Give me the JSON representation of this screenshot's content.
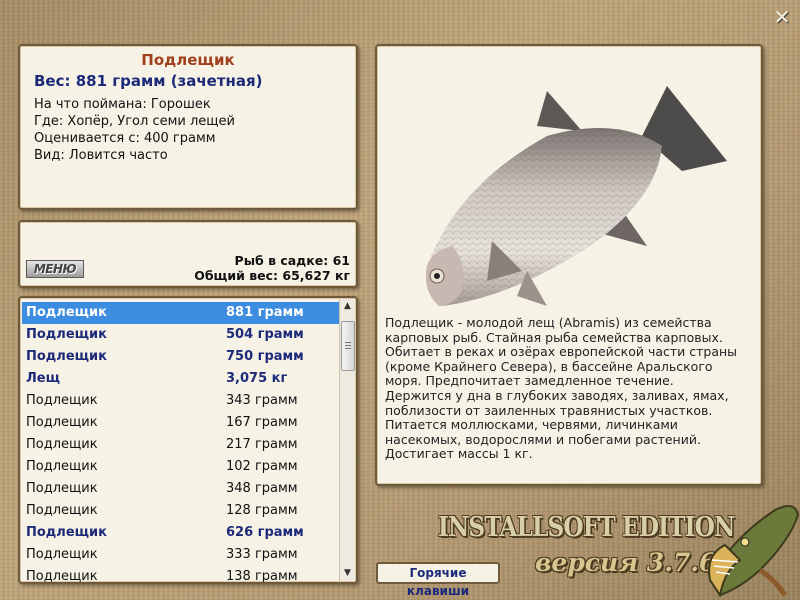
{
  "info": {
    "title": "Подлещик",
    "weight": "Вес: 881 грамм (зачетная)",
    "bait": "На что поймана: Горошек",
    "place": "Где: Хопёр, Угол семи лещей",
    "rated_from": "Оценивается с: 400 грамм",
    "kind": "Вид: Ловится часто"
  },
  "counts": {
    "menu_label": "МЕНЮ",
    "fish_in_keepnet": "Рыб в садке: 61",
    "total_weight": "Общий вес: 65,627 кг"
  },
  "catch_list": [
    {
      "name": "Подлещик",
      "weight": "881 грамм",
      "style": "sel"
    },
    {
      "name": "Подлещик",
      "weight": "504 грамм",
      "style": "bold"
    },
    {
      "name": "Подлещик",
      "weight": "750 грамм",
      "style": "bold"
    },
    {
      "name": "Лещ",
      "weight": "3,075 кг",
      "style": "bold"
    },
    {
      "name": "Подлещик",
      "weight": "343 грамм",
      "style": "normal"
    },
    {
      "name": "Подлещик",
      "weight": "167 грамм",
      "style": "normal"
    },
    {
      "name": "Подлещик",
      "weight": "217 грамм",
      "style": "normal"
    },
    {
      "name": "Подлещик",
      "weight": "102 грамм",
      "style": "normal"
    },
    {
      "name": "Подлещик",
      "weight": "348 грамм",
      "style": "normal"
    },
    {
      "name": "Подлещик",
      "weight": "128 грамм",
      "style": "normal"
    },
    {
      "name": "Подлещик",
      "weight": "626 грамм",
      "style": "bold"
    },
    {
      "name": "Подлещик",
      "weight": "333 грамм",
      "style": "normal"
    },
    {
      "name": "Подлещик",
      "weight": "138 грамм",
      "style": "normal"
    }
  ],
  "description": "Подлещик - молодой лещ (Abramis) из семейства карповых рыб. Стайная рыба семейства карповых. Обитает в реках и озёрах европейской части страны (кроме Крайнего Севера), в бассейне Аральского моря. Предпочитает замедленное течение. Держится у дна в глубоких заводях, заливах, ямах, поблизости от заиленных травянистых участков. Питается моллюсками, червями, личинками насекомых, водорослями и побегами растений. Достигает массы 1 кг.",
  "buttons": {
    "close": "✕",
    "hotkeys": "Горячие клавиши"
  },
  "branding": {
    "edition": "INSTALLSOFT EDITION",
    "version": "версия 3.7.6"
  },
  "icons": {
    "close": "close-icon",
    "scroll_up": "arrow-up-icon",
    "scroll_down": "arrow-down-icon"
  },
  "colors": {
    "selected_row": "#3c8ce0",
    "title": "#a0401c",
    "bold_text": "#1d2a7a"
  }
}
